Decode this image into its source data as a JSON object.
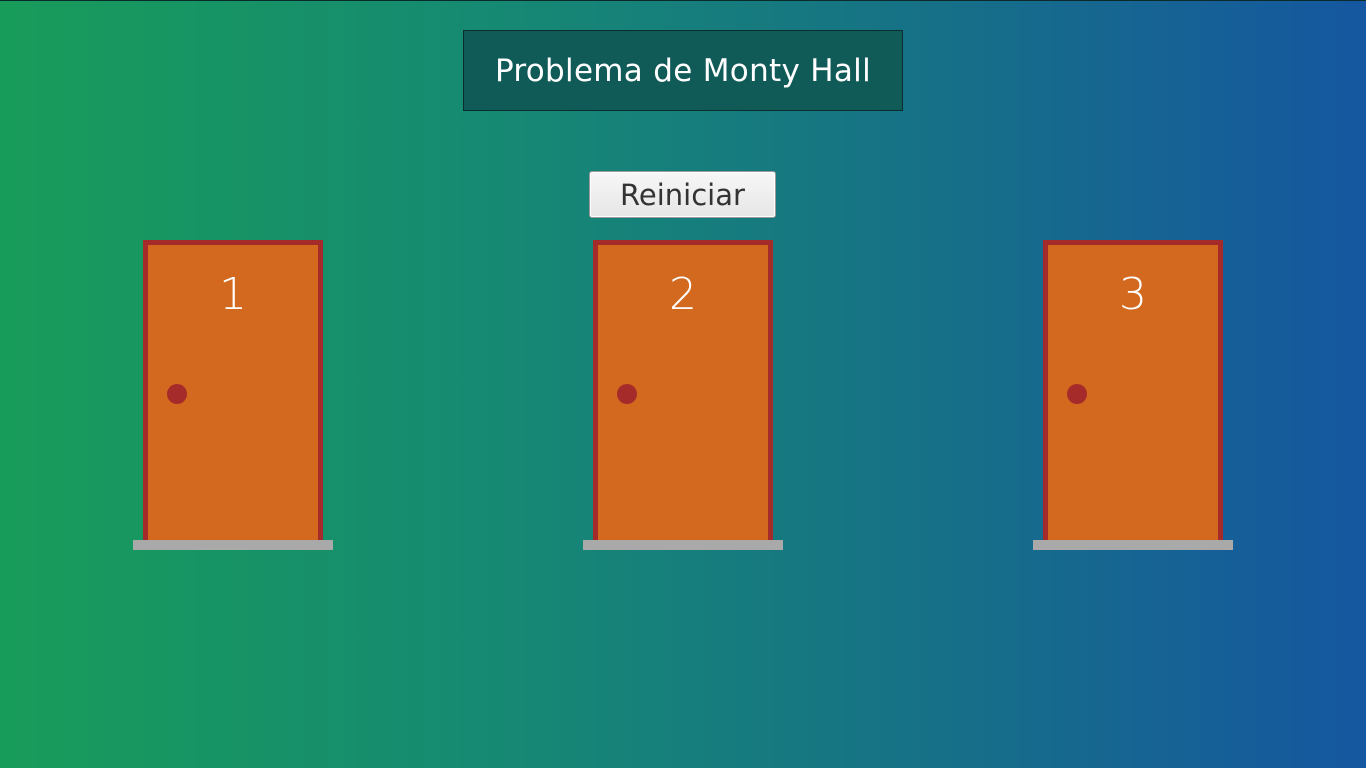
{
  "game": {
    "title": "Problema de Monty Hall",
    "reset_label": "Reiniciar"
  },
  "doors": [
    {
      "number": "1"
    },
    {
      "number": "2"
    },
    {
      "number": "3"
    }
  ],
  "colors": {
    "door": "#d2691e",
    "door_frame": "#a52a2a",
    "door_step": "#a9a9a9",
    "title_background": "#105b58",
    "background_left": "#189c5a",
    "background_right": "#1557a0"
  }
}
